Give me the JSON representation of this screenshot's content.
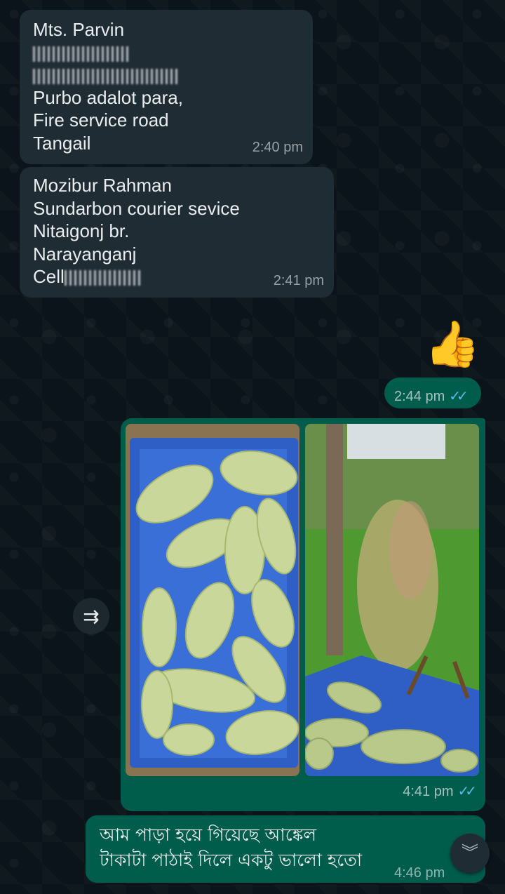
{
  "messages": {
    "m1": {
      "lines": [
        "Mts. Parvin",
        "Purbo adalot para,",
        "Fire service road",
        "Tangail"
      ],
      "time": "2:40 pm"
    },
    "m2": {
      "lines": [
        "Mozibur Rahman",
        "Sundarbon courier sevice",
        "Nitaigonj br.",
        "Narayanganj",
        "Cell"
      ],
      "time": "2:41 pm"
    },
    "m3": {
      "emoji": "👍",
      "time": "2:44 pm",
      "status": "✓✓"
    },
    "m4": {
      "time": "4:41 pm",
      "status": "✓✓"
    },
    "m5": {
      "lines": [
        "আম পাড়া হয়ে গিয়েছে আঙ্কেল",
        "টাকাটা পাঠাই দিলে একটু ভালো হতো"
      ],
      "time": "4:46 pm"
    }
  },
  "icons": {
    "forward": "forward-icon",
    "scroll": "chevron-double-down-icon"
  },
  "colors": {
    "incoming": "#202c33",
    "outgoing": "#005c4b",
    "read_ticks": "#53bdeb"
  }
}
